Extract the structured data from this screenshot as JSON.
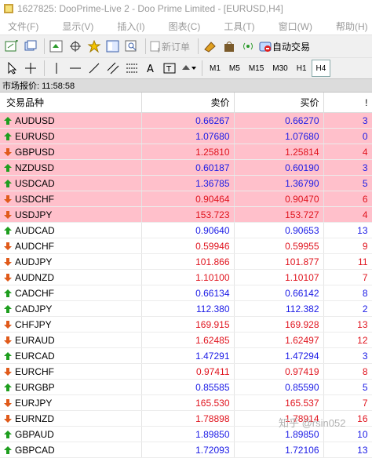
{
  "window": {
    "title": "1627825: DooPrime-Live 2 - Doo Prime Limited - [EURUSD,H4]"
  },
  "menu": [
    "文件(F)",
    "显示(V)",
    "插入(I)",
    "图表(C)",
    "工具(T)",
    "窗口(W)",
    "帮助(H)"
  ],
  "toolbar": {
    "new_order": "新订单",
    "auto_trading": "自动交易"
  },
  "timeframes": [
    "M1",
    "M5",
    "M15",
    "M30",
    "H1",
    "H4"
  ],
  "active_timeframe": "H4",
  "market_watch": {
    "header": "市场报价: 11:58:58",
    "columns": {
      "symbol": "交易品种",
      "bid": "卖价",
      "ask": "买价",
      "spread": "!"
    },
    "rows": [
      {
        "symbol": "AUDUSD",
        "bid": "0.66267",
        "ask": "0.66270",
        "spread": "3",
        "dir": "up",
        "highlight": true
      },
      {
        "symbol": "EURUSD",
        "bid": "1.07680",
        "ask": "1.07680",
        "spread": "0",
        "dir": "up",
        "highlight": true
      },
      {
        "symbol": "GBPUSD",
        "bid": "1.25810",
        "ask": "1.25814",
        "spread": "4",
        "dir": "down",
        "highlight": true
      },
      {
        "symbol": "NZDUSD",
        "bid": "0.60187",
        "ask": "0.60190",
        "spread": "3",
        "dir": "up",
        "highlight": true
      },
      {
        "symbol": "USDCAD",
        "bid": "1.36785",
        "ask": "1.36790",
        "spread": "5",
        "dir": "up",
        "highlight": true
      },
      {
        "symbol": "USDCHF",
        "bid": "0.90464",
        "ask": "0.90470",
        "spread": "6",
        "dir": "down",
        "highlight": true
      },
      {
        "symbol": "USDJPY",
        "bid": "153.723",
        "ask": "153.727",
        "spread": "4",
        "dir": "down",
        "highlight": true
      },
      {
        "symbol": "AUDCAD",
        "bid": "0.90640",
        "ask": "0.90653",
        "spread": "13",
        "dir": "up",
        "highlight": false
      },
      {
        "symbol": "AUDCHF",
        "bid": "0.59946",
        "ask": "0.59955",
        "spread": "9",
        "dir": "down",
        "highlight": false
      },
      {
        "symbol": "AUDJPY",
        "bid": "101.866",
        "ask": "101.877",
        "spread": "11",
        "dir": "down",
        "highlight": false
      },
      {
        "symbol": "AUDNZD",
        "bid": "1.10100",
        "ask": "1.10107",
        "spread": "7",
        "dir": "down",
        "highlight": false
      },
      {
        "symbol": "CADCHF",
        "bid": "0.66134",
        "ask": "0.66142",
        "spread": "8",
        "dir": "up",
        "highlight": false
      },
      {
        "symbol": "CADJPY",
        "bid": "112.380",
        "ask": "112.382",
        "spread": "2",
        "dir": "up",
        "highlight": false
      },
      {
        "symbol": "CHFJPY",
        "bid": "169.915",
        "ask": "169.928",
        "spread": "13",
        "dir": "down",
        "highlight": false
      },
      {
        "symbol": "EURAUD",
        "bid": "1.62485",
        "ask": "1.62497",
        "spread": "12",
        "dir": "down",
        "highlight": false
      },
      {
        "symbol": "EURCAD",
        "bid": "1.47291",
        "ask": "1.47294",
        "spread": "3",
        "dir": "up",
        "highlight": false
      },
      {
        "symbol": "EURCHF",
        "bid": "0.97411",
        "ask": "0.97419",
        "spread": "8",
        "dir": "down",
        "highlight": false
      },
      {
        "symbol": "EURGBP",
        "bid": "0.85585",
        "ask": "0.85590",
        "spread": "5",
        "dir": "up",
        "highlight": false
      },
      {
        "symbol": "EURJPY",
        "bid": "165.530",
        "ask": "165.537",
        "spread": "7",
        "dir": "down",
        "highlight": false
      },
      {
        "symbol": "EURNZD",
        "bid": "1.78898",
        "ask": "1.78914",
        "spread": "16",
        "dir": "down",
        "highlight": false
      },
      {
        "symbol": "GBPAUD",
        "bid": "1.89850",
        "ask": "1.89850",
        "spread": "10",
        "dir": "up",
        "highlight": false
      },
      {
        "symbol": "GBPCAD",
        "bid": "1.72093",
        "ask": "1.72106",
        "spread": "13",
        "dir": "up",
        "highlight": false
      }
    ]
  },
  "watermark": "知乎 @rsin052",
  "colors": {
    "up": "#1a1ae6",
    "down": "#e0141e",
    "highlight_row": "#ffc0cb",
    "up_arrow": "#1e9e1e",
    "down_arrow": "#e05a1a"
  }
}
